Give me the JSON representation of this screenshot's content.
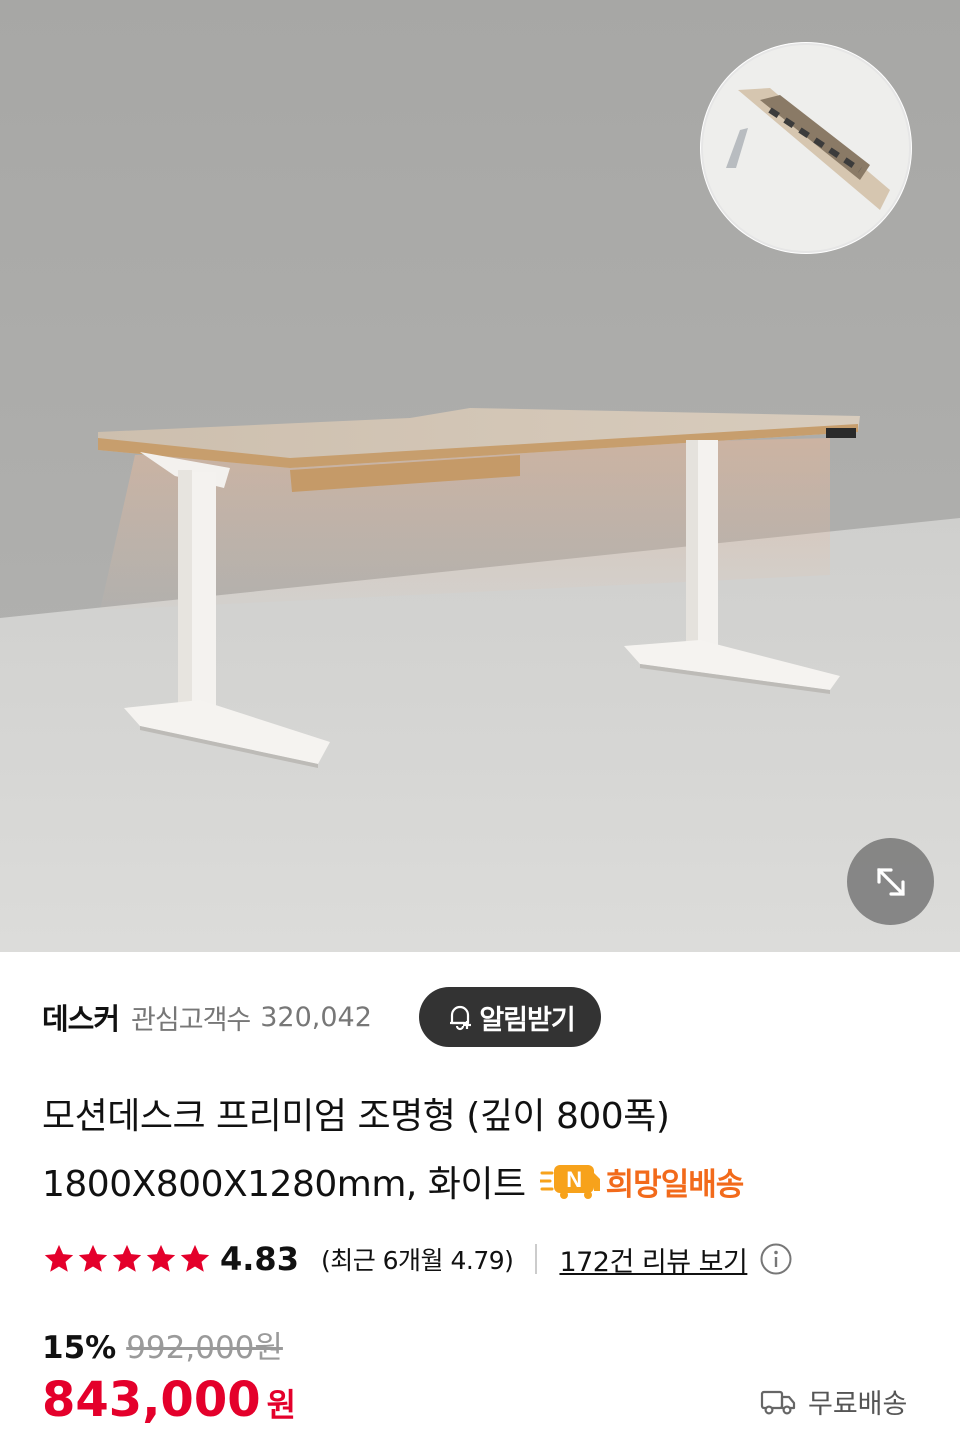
{
  "product_image": {
    "alt": "모션데스크 프리미엄 조명형",
    "expand_icon": "expand-arrows-icon"
  },
  "store": {
    "name": "데스커",
    "fans_label": "관심고객수",
    "fans_count": "320,042",
    "alarm_button": "알림받기",
    "alarm_icon": "bell-plus-icon"
  },
  "product": {
    "title_line1": "모션데스크 프리미엄 조명형 (깊이 800폭)",
    "title_line2": "1800X800X1280mm, 화이트",
    "delivery_badge": {
      "icon": "n-truck-icon",
      "text": "희망일배송",
      "color": "#f26a1b"
    }
  },
  "rating": {
    "stars": 5,
    "star_color": "#e4002b",
    "value": "4.83",
    "recent": "(최근 6개월 4.79)",
    "review_link": "172건 리뷰 보기",
    "info_icon": "info-circle-icon"
  },
  "price": {
    "discount_rate": "15%",
    "original": "992,000원",
    "sale": "843,000",
    "currency": "원",
    "sale_color": "#e4002b"
  },
  "shipping": {
    "icon": "truck-icon",
    "label": "무료배송"
  }
}
